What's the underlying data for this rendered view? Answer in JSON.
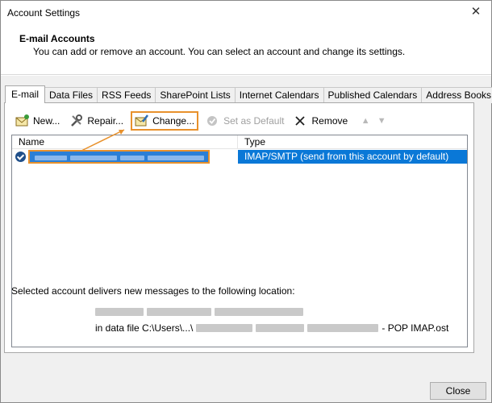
{
  "window": {
    "title": "Account Settings",
    "close_glyph": "✕"
  },
  "header": {
    "title": "E-mail Accounts",
    "description": "You can add or remove an account. You can select an account and change its settings."
  },
  "tabs": [
    {
      "label": "E-mail",
      "active": true
    },
    {
      "label": "Data Files"
    },
    {
      "label": "RSS Feeds"
    },
    {
      "label": "SharePoint Lists"
    },
    {
      "label": "Internet Calendars"
    },
    {
      "label": "Published Calendars"
    },
    {
      "label": "Address Books"
    }
  ],
  "toolbar": {
    "new_label": "New...",
    "repair_label": "Repair...",
    "change_label": "Change...",
    "set_default_label": "Set as Default",
    "remove_label": "Remove"
  },
  "list": {
    "columns": {
      "name": "Name",
      "type": "Type"
    },
    "rows": [
      {
        "type": "IMAP/SMTP (send from this account by default)"
      }
    ]
  },
  "location": {
    "description": "Selected account delivers new messages to the following location:",
    "data_file_prefix": "in data file C:\\Users\\...\\",
    "data_file_suffix": "- POP IMAP.ost"
  },
  "footer": {
    "close_label": "Close"
  },
  "colors": {
    "selection": "#0a78d7",
    "highlight": "#e8912c"
  }
}
